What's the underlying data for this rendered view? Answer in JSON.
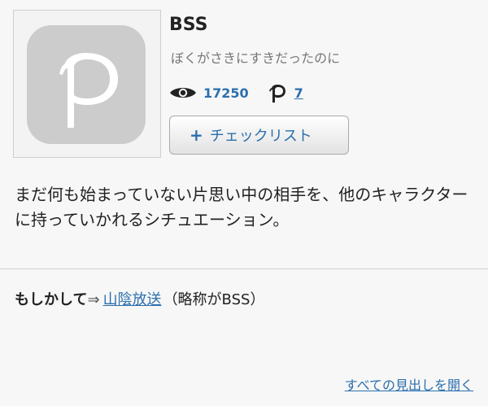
{
  "article": {
    "title": "BSS",
    "reading": "ぼくがさきにすきだったのに",
    "views": "17250",
    "pixiv_count": "7",
    "checklist_plus": "+",
    "checklist_label": "チェックリスト",
    "description": "まだ何も始まっていない片思い中の相手を、他のキャラクターに持っていかれるシチュエーション。"
  },
  "maybe": {
    "label": "もしかして",
    "arrow": "⇒",
    "link": "山陰放送",
    "note": "（略称がBSS）"
  },
  "headings": {
    "open_all": "すべての見出しを開く"
  },
  "icons": {
    "app_icon": "pixiv-p-logo",
    "views_icon": "eye-icon",
    "pixiv_icon": "pixiv-p-icon"
  },
  "colors": {
    "link": "#2b6fad",
    "icon_bg": "#cccccc",
    "background": "#f7f7f7"
  }
}
